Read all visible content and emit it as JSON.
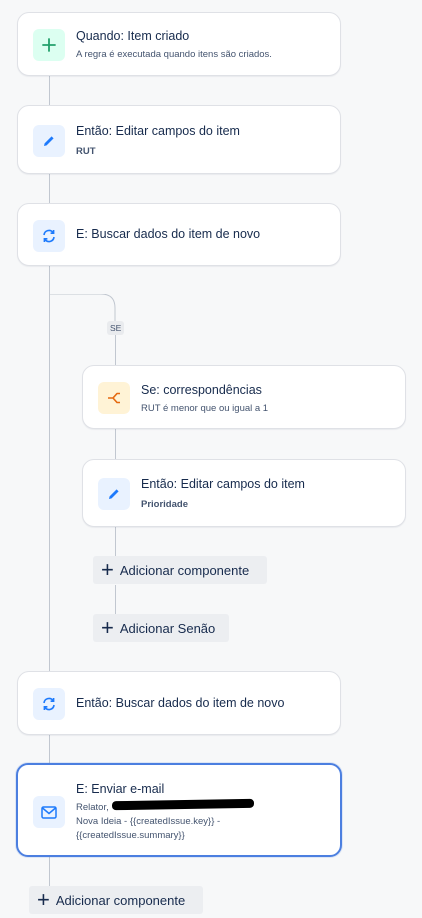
{
  "flow": {
    "trigger": {
      "title": "Quando: Item criado",
      "subtitle": "A regra é executada quando itens são criados.",
      "icon": "plus-icon"
    },
    "edit1": {
      "title": "Então: Editar campos do item",
      "subtitle": "RUT",
      "icon": "pencil-icon"
    },
    "refetch1": {
      "title": "E: Buscar dados do item de novo",
      "icon": "refresh-icon"
    },
    "branch_label": "SE",
    "condition": {
      "title": "Se: correspondências",
      "subtitle": "RUT é menor que ou igual a 1",
      "icon": "branch-icon"
    },
    "edit2": {
      "title": "Então: Editar campos do item",
      "subtitle": "Prioridade",
      "icon": "pencil-icon"
    },
    "add_component_inner": "Adicionar componente",
    "add_else": "Adicionar Senão",
    "refetch2": {
      "title": "Então: Buscar dados do item de novo",
      "icon": "refresh-icon"
    },
    "email": {
      "title": "E: Enviar e-mail",
      "line1": "Relator,",
      "line2": "Nova Ideia - {{createdIssue.key}} -",
      "line3": "{{createdIssue.summary}}",
      "icon": "mail-icon"
    },
    "add_component_outer": "Adicionar componente"
  },
  "colors": {
    "accent_blue": "#1d7afc",
    "green": "#22a06b",
    "orange": "#e56910",
    "selected_border": "#4c7fe0"
  }
}
